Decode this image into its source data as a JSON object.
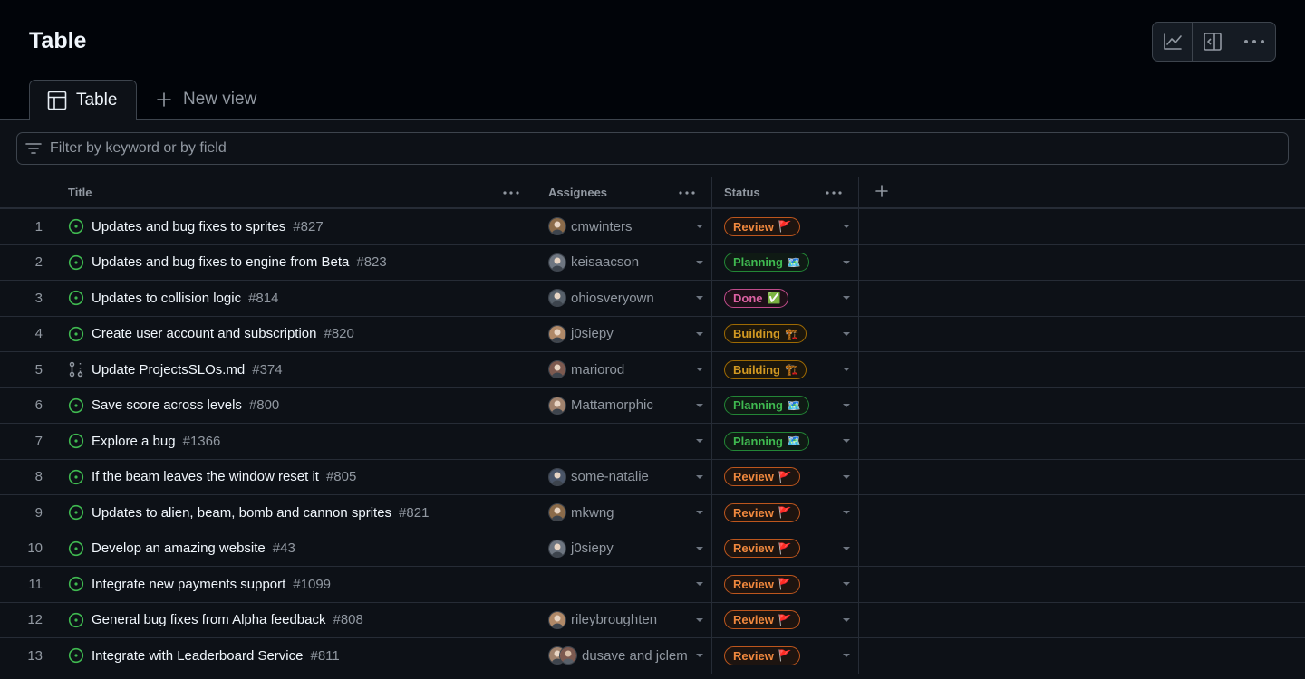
{
  "header": {
    "title": "Table"
  },
  "toolbar": {
    "items": [
      "chart-icon",
      "sidebar-panel-icon",
      "more-icon"
    ]
  },
  "tabs": {
    "active_label": "Table",
    "new_view_label": "New view"
  },
  "filter": {
    "placeholder": "Filter by keyword or by field",
    "value": ""
  },
  "table": {
    "columns": {
      "title": "Title",
      "assignees": "Assignees",
      "status": "Status"
    },
    "rows": [
      {
        "num": "1",
        "type": "issue",
        "title": "Updates and bug fixes to sprites",
        "ref": "#827",
        "assignees": "cmwinters",
        "avatars": 1,
        "status": "Review",
        "status_emoji": "🚩"
      },
      {
        "num": "2",
        "type": "issue",
        "title": "Updates and bug fixes to engine from Beta",
        "ref": "#823",
        "assignees": "keisaacson",
        "avatars": 1,
        "status": "Planning",
        "status_emoji": "🗺️"
      },
      {
        "num": "3",
        "type": "issue",
        "title": "Updates to collision logic",
        "ref": "#814",
        "assignees": "ohiosveryown",
        "avatars": 1,
        "status": "Done",
        "status_emoji": "✅"
      },
      {
        "num": "4",
        "type": "issue",
        "title": "Create user account and subscription",
        "ref": "#820",
        "assignees": "j0siepy",
        "avatars": 1,
        "status": "Building",
        "status_emoji": "🏗️"
      },
      {
        "num": "5",
        "type": "pr",
        "title": "Update ProjectsSLOs.md",
        "ref": "#374",
        "assignees": "mariorod",
        "avatars": 1,
        "status": "Building",
        "status_emoji": "🏗️"
      },
      {
        "num": "6",
        "type": "issue",
        "title": "Save score across levels",
        "ref": "#800",
        "assignees": "Mattamorphic",
        "avatars": 1,
        "status": "Planning",
        "status_emoji": "🗺️"
      },
      {
        "num": "7",
        "type": "issue",
        "title": "Explore a bug",
        "ref": "#1366",
        "assignees": "",
        "avatars": 0,
        "status": "Planning",
        "status_emoji": "🗺️"
      },
      {
        "num": "8",
        "type": "issue",
        "title": "If the beam leaves the window reset it",
        "ref": "#805",
        "assignees": "some-natalie",
        "avatars": 1,
        "status": "Review",
        "status_emoji": "🚩"
      },
      {
        "num": "9",
        "type": "issue",
        "title": "Updates to alien, beam, bomb and cannon sprites",
        "ref": "#821",
        "assignees": "mkwng",
        "avatars": 1,
        "status": "Review",
        "status_emoji": "🚩"
      },
      {
        "num": "10",
        "type": "issue",
        "title": "Develop an amazing website",
        "ref": "#43",
        "assignees": "j0siepy",
        "avatars": 1,
        "status": "Review",
        "status_emoji": "🚩"
      },
      {
        "num": "11",
        "type": "issue",
        "title": "Integrate new payments support",
        "ref": "#1099",
        "assignees": "",
        "avatars": 0,
        "status": "Review",
        "status_emoji": "🚩"
      },
      {
        "num": "12",
        "type": "issue",
        "title": "General bug fixes from Alpha feedback",
        "ref": "#808",
        "assignees": "rileybroughten",
        "avatars": 1,
        "status": "Review",
        "status_emoji": "🚩"
      },
      {
        "num": "13",
        "type": "issue",
        "title": "Integrate with Leaderboard Service",
        "ref": "#811",
        "assignees": "dusave and jclem",
        "avatars": 2,
        "status": "Review",
        "status_emoji": "🚩"
      }
    ]
  },
  "colors": {
    "open_issue": "#3fb950",
    "pr_icon": "#9198a1",
    "review": "#f0883e",
    "planning": "#3fb950",
    "done": "#db61a2",
    "building": "#d29922"
  }
}
